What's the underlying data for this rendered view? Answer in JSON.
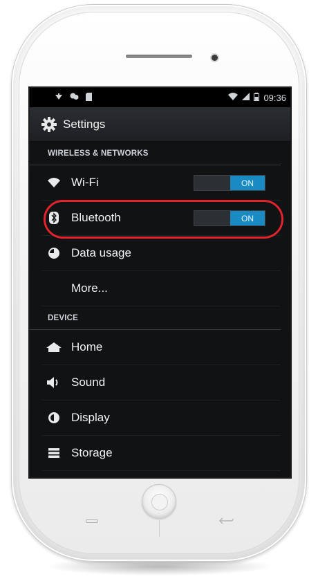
{
  "status_bar": {
    "time": "09:36"
  },
  "action_bar": {
    "title": "Settings"
  },
  "sections": {
    "wireless": {
      "header": "WIRELESS & NETWORKS",
      "wifi": {
        "label": "Wi-Fi",
        "toggle": "ON"
      },
      "bluetooth": {
        "label": "Bluetooth",
        "toggle": "ON"
      },
      "data_usage": {
        "label": "Data usage"
      },
      "more": {
        "label": "More..."
      }
    },
    "device": {
      "header": "DEVICE",
      "home": {
        "label": "Home"
      },
      "sound": {
        "label": "Sound"
      },
      "display": {
        "label": "Display"
      },
      "storage": {
        "label": "Storage"
      }
    }
  },
  "colors": {
    "toggle_on": "#1a8ac2",
    "highlight_ring": "#e3232c",
    "screen_bg": "#101214"
  },
  "icons": {
    "status_left": [
      "notification-icon",
      "chat-icon",
      "sdcard-icon"
    ],
    "status_right": [
      "wifi-signal-icon",
      "cell-signal-icon",
      "battery-icon"
    ],
    "settings": "gear-icon",
    "wifi": "wifi-icon",
    "bluetooth": "bluetooth-icon",
    "data_usage": "pie-chart-icon",
    "home": "home-icon",
    "sound": "speaker-icon",
    "display": "brightness-icon",
    "storage": "storage-icon"
  }
}
